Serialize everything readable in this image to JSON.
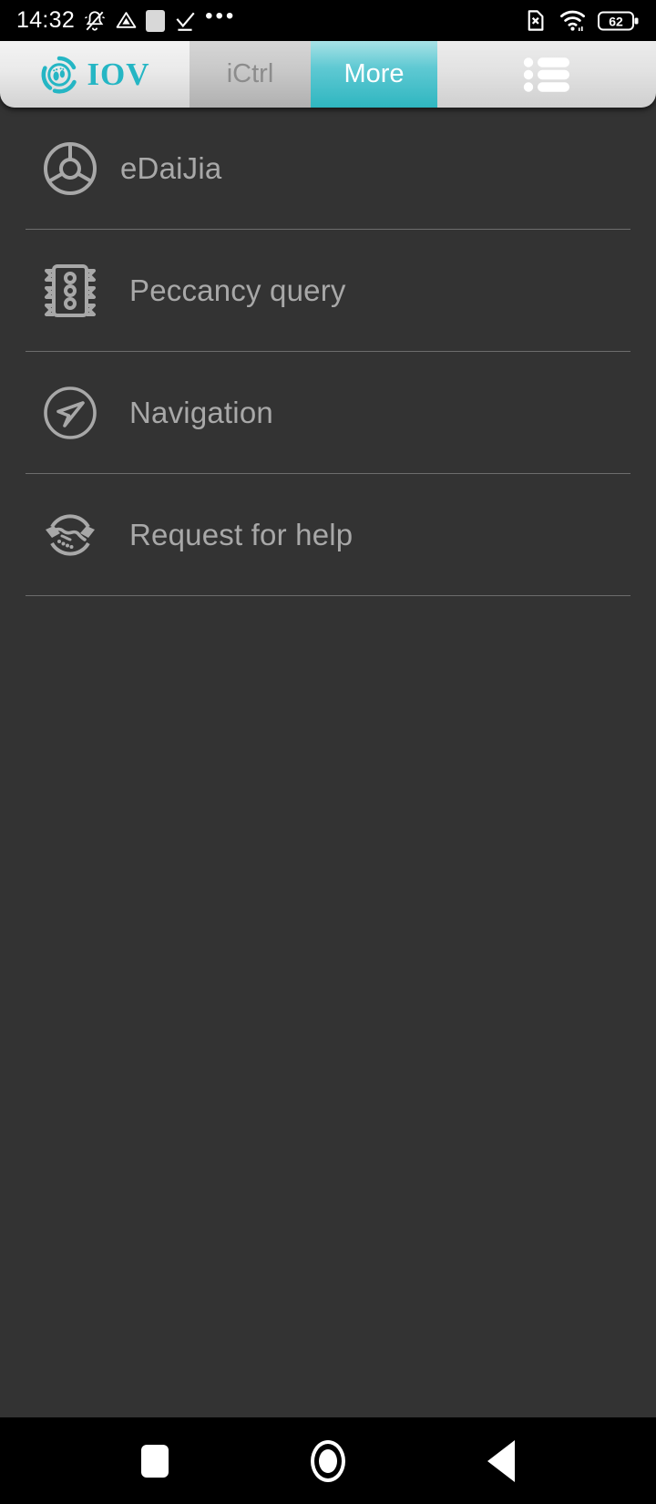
{
  "status_bar": {
    "time": "14:32",
    "left_icons": [
      "bell-mute-icon",
      "drive-triangle-icon",
      "white-square-icon",
      "checkmark-icon",
      "overflow-dots-icon"
    ],
    "right_icons": [
      "no-sim-icon",
      "wifi-icon"
    ],
    "battery_level": "62"
  },
  "tabbar": {
    "logo_text": "IOV",
    "logo_icon": "iov-footprint-logo",
    "tabs": [
      {
        "label": "iCtrl",
        "active": false
      },
      {
        "label": "More",
        "active": true
      }
    ],
    "menu_icon": "list-menu-icon"
  },
  "menu": {
    "items": [
      {
        "label": "eDaiJia",
        "icon": "steering-wheel-icon"
      },
      {
        "label": "Peccancy query",
        "icon": "traffic-light-icon"
      },
      {
        "label": "Navigation",
        "icon": "navigation-arrow-icon"
      },
      {
        "label": "Request for help",
        "icon": "handshake-icon"
      }
    ]
  },
  "navbar": {
    "buttons": [
      {
        "name": "recents",
        "icon": "square-icon"
      },
      {
        "name": "home",
        "icon": "circle-icon"
      },
      {
        "name": "back",
        "icon": "triangle-left-icon"
      }
    ]
  },
  "colors": {
    "accent_teal": "#2fb6c0",
    "content_bg": "#333333",
    "text_muted": "#a8a8a8"
  }
}
